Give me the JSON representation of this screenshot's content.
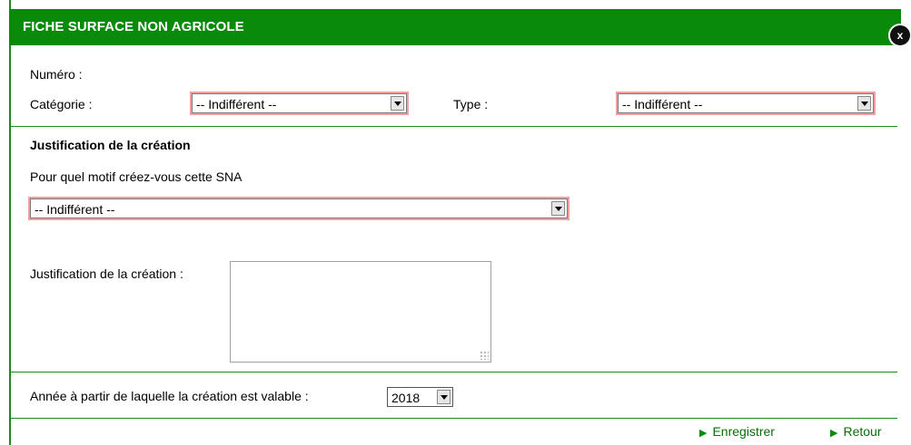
{
  "dialog": {
    "title": "FICHE SURFACE NON AGRICOLE",
    "close_label": "x"
  },
  "form": {
    "numero_label": "Numéro :",
    "categorie_label": "Catégorie :",
    "categorie_value": "-- Indifférent --",
    "type_label": "Type :",
    "type_value": "-- Indifférent --"
  },
  "justification": {
    "section_title": "Justification de la création",
    "motif_label": "Pour quel motif créez-vous cette SNA",
    "motif_value": "-- Indifférent --",
    "text_label": "Justification de la création :",
    "text_value": ""
  },
  "annee": {
    "label": "Année à partir de laquelle la création est valable :",
    "value": "2018"
  },
  "actions": {
    "save_label": "Enregistrer",
    "back_label": "Retour"
  },
  "colors": {
    "header_green": "#0a8a0a",
    "required_outline": "#f0a0a0"
  }
}
